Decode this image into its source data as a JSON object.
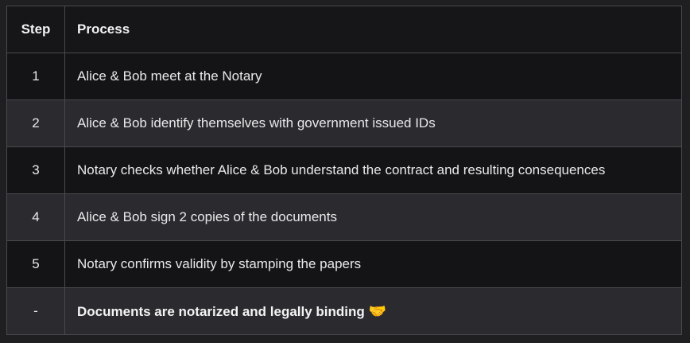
{
  "table": {
    "headers": {
      "step": "Step",
      "process": "Process"
    },
    "rows": [
      {
        "step": "1",
        "process": "Alice & Bob meet at the Notary"
      },
      {
        "step": "2",
        "process": "Alice & Bob identify themselves with government issued IDs"
      },
      {
        "step": "3",
        "process": "Notary checks whether Alice & Bob understand the contract and resulting consequences"
      },
      {
        "step": "4",
        "process": "Alice & Bob sign 2 copies of the documents"
      },
      {
        "step": "5",
        "process": "Notary confirms validity by stamping the papers"
      },
      {
        "step": "-",
        "process": "Documents are notarized and legally binding",
        "emoji": "🤝",
        "emphasis": true
      }
    ]
  },
  "colors": {
    "background": "#1f1f21",
    "row_dark": "#141416",
    "row_light": "#2b2b2f",
    "border": "#4a4a4e",
    "text": "#e9e9ea"
  }
}
